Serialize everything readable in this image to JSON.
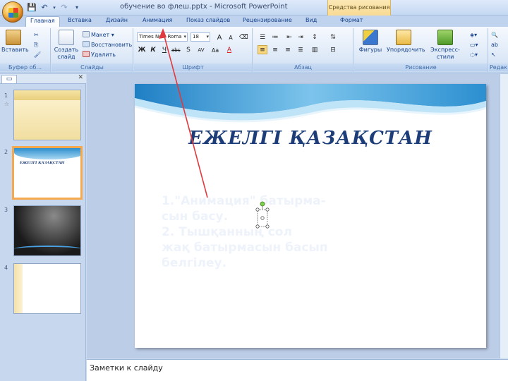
{
  "window": {
    "title": "обучение во флеш.pptx - Microsoft PowerPoint",
    "context_group": "Средства рисования"
  },
  "tabs": [
    {
      "label": "Главная",
      "active": true
    },
    {
      "label": "Вставка"
    },
    {
      "label": "Дизайн"
    },
    {
      "label": "Анимация"
    },
    {
      "label": "Показ слайдов"
    },
    {
      "label": "Рецензирование"
    },
    {
      "label": "Вид"
    },
    {
      "label": "Формат"
    }
  ],
  "ribbon": {
    "clipboard": {
      "paste": "Вставить",
      "group": "Буфер об..."
    },
    "slides": {
      "new_slide": "Создать слайд",
      "layout": "Макет",
      "reset": "Восстановить",
      "delete": "Удалить",
      "group": "Слайды"
    },
    "font": {
      "font_name": "Times New Roma",
      "font_size": "18",
      "group": "Шрифт",
      "bold": "Ж",
      "italic": "К",
      "underline": "Ч",
      "strike": "abc",
      "shadow": "S",
      "spacing": "AV",
      "case": "Aa",
      "color": "A",
      "grow": "A",
      "shrink": "A"
    },
    "paragraph": {
      "group": "Абзац"
    },
    "drawing": {
      "shapes": "Фигуры",
      "arrange": "Упорядочить",
      "quick_styles": "Экспресс-стили",
      "group": "Рисование"
    },
    "editing": {
      "group": "Редак"
    }
  },
  "thumbnails": [
    {
      "num": "1",
      "star": "☆"
    },
    {
      "num": "2",
      "title": "ЕЖЕЛГІ ҚАЗАҚСТАН"
    },
    {
      "num": "3"
    },
    {
      "num": "4"
    }
  ],
  "slide": {
    "title": "ЕЖЕЛГІ   ҚАЗАҚСТАН",
    "body": "1.\"Анимация\" батырма-\nсын басу.\n2. Тышқанның сол\nжақ батырмасын басып\nбелгілеу."
  },
  "notes": {
    "placeholder": "Заметки к слайду"
  },
  "colors": {
    "annotation_arrow": "#e0393e",
    "slide_title": "#1c3d78",
    "ribbon_text": "#15428b"
  }
}
